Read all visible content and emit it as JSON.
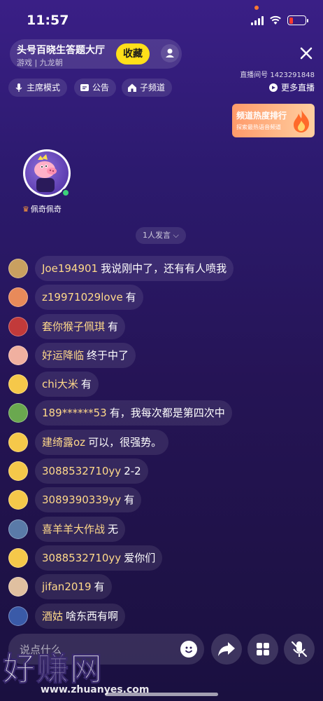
{
  "status_bar": {
    "time": "11:57"
  },
  "room": {
    "title": "头号百晓生答题大厅",
    "subtitle": "游戏 | 九龙朝",
    "favorite_label": "收藏",
    "room_id": "直播间号 1423291848"
  },
  "modes": {
    "host_mode": "主席模式",
    "notice": "公告",
    "sub_channel": "子频道",
    "more_live": "更多直播"
  },
  "heat_card": {
    "title": "频道热度排行",
    "subtitle": "探索最热语音频道"
  },
  "host": {
    "name": "佩奇佩奇"
  },
  "speaker_count": "1人发言",
  "messages": [
    {
      "user": "Joe194901",
      "text": "我说刚中了，还有有人喷我",
      "avatar": "#c9a060"
    },
    {
      "user": "z19971029love",
      "text": "有",
      "avatar": "#e88a5a"
    },
    {
      "user": "套你猴子佩琪",
      "text": "有",
      "avatar": "#c23a3a"
    },
    {
      "user": "好运降临",
      "text": "终于中了",
      "avatar": "#f0b0a0"
    },
    {
      "user": "chi大米",
      "text": "有",
      "avatar": "#f5c84a"
    },
    {
      "user": "189******53",
      "text": "有，我每次都是第四次中",
      "avatar": "#6aa84f"
    },
    {
      "user": "建绮露oz",
      "text": "可以，很强势。",
      "avatar": "#f5c84a"
    },
    {
      "user": "3088532710yy",
      "text": "2-2",
      "avatar": "#f5c84a"
    },
    {
      "user": "3089390339yy",
      "text": "有",
      "avatar": "#f5c84a"
    },
    {
      "user": "喜羊羊大作战",
      "text": "无",
      "avatar": "#5a7aa8"
    },
    {
      "user": "3088532710yy",
      "text": "爱你们",
      "avatar": "#f5c84a"
    },
    {
      "user": "jifan2019",
      "text": "有",
      "avatar": "#e0c0a0"
    },
    {
      "user": "酒姑",
      "text": "啥东西有啊",
      "avatar": "#3a5aa8"
    }
  ],
  "bottom": {
    "input_placeholder": "说点什么"
  },
  "watermark": {
    "big": "好赚网",
    "url": "www.zhuanyes.com"
  }
}
